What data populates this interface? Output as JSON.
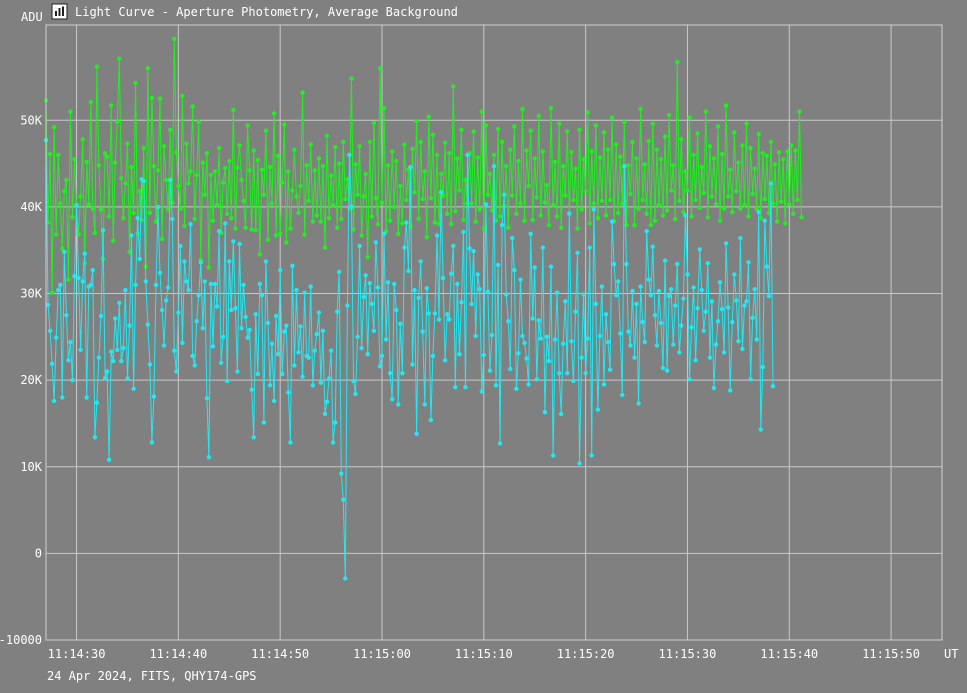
{
  "window": {
    "title": "Light Curve - Aperture Photometry, Average Background",
    "icon": "chart-icon"
  },
  "footer": "24 Apr 2024, FITS, QHY174-GPS",
  "colors": {
    "background": "#808080",
    "grid": "#c8c8c8",
    "series_green": "#22ee22",
    "series_cyan": "#22e8f2"
  },
  "chart_data": {
    "type": "line",
    "title": "Light Curve - Aperture Photometry, Average Background",
    "ylabel": "ADU",
    "xlabel": "UT",
    "ylim": [
      -10000,
      61000
    ],
    "xlim": [
      27,
      115
    ],
    "yticks": [
      {
        "value": 50000,
        "label": "50K"
      },
      {
        "value": 40000,
        "label": "40K"
      },
      {
        "value": 30000,
        "label": "30K"
      },
      {
        "value": 20000,
        "label": "20K"
      },
      {
        "value": 10000,
        "label": "10K"
      },
      {
        "value": 0,
        "label": "0"
      },
      {
        "value": -10000,
        "label": "-10000"
      }
    ],
    "xticks": [
      {
        "value": 30,
        "label": "11:14:30"
      },
      {
        "value": 40,
        "label": "11:14:40"
      },
      {
        "value": 50,
        "label": "11:14:50"
      },
      {
        "value": 60,
        "label": "11:15:00"
      },
      {
        "value": 70,
        "label": "11:15:10"
      },
      {
        "value": 80,
        "label": "11:15:20"
      },
      {
        "value": 90,
        "label": "11:15:30"
      },
      {
        "value": 100,
        "label": "11:15:40"
      },
      {
        "value": 110,
        "label": "11:15:50"
      }
    ],
    "grid": true,
    "x_start": 27,
    "x_step": 0.2,
    "series": [
      {
        "color": "#22ee22",
        "values": [
          52300,
          38200,
          46100,
          30100,
          49200,
          36800,
          46000,
          40400,
          35200,
          41800,
          43100,
          31600,
          51000,
          38800,
          45500,
          40200,
          36800,
          41200,
          47800,
          33500,
          45200,
          40300,
          52100,
          39800,
          37000,
          56200,
          44800,
          39700,
          34000,
          46200,
          45800,
          38900,
          51700,
          36100,
          45100,
          49800,
          57100,
          43300,
          38700,
          42700,
          47300,
          34800,
          44600,
          39300,
          54300,
          36900,
          41800,
          38500,
          46800,
          33100,
          56000,
          39300,
          52600,
          44700,
          38300,
          44200,
          52500,
          36300,
          47000,
          43100,
          39700,
          48900,
          40500,
          59400,
          46300,
          42400,
          39800,
          52800,
          37800,
          47300,
          42700,
          44100,
          51600,
          38600,
          43700,
          49800,
          33900,
          45100,
          41400,
          46200,
          33000,
          43700,
          38400,
          44100,
          40200,
          46800,
          37000,
          42800,
          44500,
          39200,
          45300,
          38700,
          51200,
          37500,
          44500,
          47100,
          43100,
          40700,
          37600,
          49400,
          44200,
          37400,
          46500,
          37300,
          45400,
          34500,
          44300,
          41400,
          48800,
          36200,
          44600,
          40400,
          50800,
          36700,
          45900,
          36900,
          42800,
          49500,
          35900,
          44100,
          37500,
          41900,
          46600,
          41200,
          39300,
          42400,
          53200,
          36800,
          44800,
          40700,
          47200,
          38300,
          44200,
          39000,
          45600,
          38300,
          44700,
          35300,
          48200,
          38700,
          43600,
          40200,
          46900,
          37600,
          45000,
          38600,
          47500,
          40900,
          43200,
          39800,
          54800,
          37400,
          44900,
          41400,
          47000,
          36700,
          41200,
          43800,
          34200,
          47500,
          38900,
          49700,
          41000,
          38000,
          56000,
          40500,
          51400,
          37200,
          44800,
          38400,
          46400,
          40000,
          45300,
          36900,
          42400,
          38100,
          47200,
          40800,
          44300,
          37700,
          46700,
          41700,
          49900,
          38600,
          47500,
          40900,
          44100,
          36500,
          50400,
          41000,
          48300,
          38200,
          46000,
          38000,
          43800,
          41300,
          47400,
          39200,
          46200,
          38000,
          53900,
          39500,
          45600,
          41900,
          48900,
          38500,
          43100,
          40400,
          46200,
          40400,
          48700,
          38300,
          45700,
          39700,
          51000,
          37500,
          49400,
          41400,
          43800,
          39600,
          46000,
          38400,
          49000,
          38900,
          47500,
          40100,
          44700,
          37600,
          46600,
          41300,
          49300,
          39200,
          45300,
          40400,
          51300,
          38400,
          46500,
          42400,
          48800,
          38500,
          45600,
          41100,
          50500,
          39000,
          46400,
          40500,
          42500,
          37900,
          51400,
          40200,
          45200,
          38900,
          49600,
          37600,
          44700,
          41300,
          48700,
          39300,
          46300,
          40800,
          44400,
          37500,
          48900,
          39700,
          45500,
          41800,
          50900,
          38100,
          46400,
          40400,
          49400,
          38700,
          45700,
          40700,
          48600,
          39000,
          46600,
          40800,
          50300,
          38300,
          47200,
          39300,
          45800,
          40400,
          49800,
          37900,
          44800,
          41500,
          47500,
          37900,
          45600,
          39800,
          51300,
          40800,
          44900,
          39200,
          47600,
          37900,
          49600,
          38400,
          46600,
          40200,
          45500,
          39000,
          48100,
          39600,
          50600,
          41900,
          44800,
          38600,
          56700,
          40700,
          47800,
          39400,
          44100,
          41900,
          50300,
          38900,
          46000,
          40800,
          48500,
          39900,
          44600,
          41600,
          51000,
          38800,
          47000,
          41200,
          45600,
          40300,
          49300,
          38400,
          46100,
          39800,
          51700,
          41200,
          44300,
          39400,
          48600,
          41800,
          45100,
          39800,
          47100,
          40200,
          49600,
          38900,
          46800,
          41500,
          44400,
          39800,
          48400,
          38700,
          46200,
          40900,
          45900,
          39300,
          47500,
          40400,
          44900,
          38300,
          46300,
          40600,
          45500,
          38100,
          46400,
          40300,
          47100,
          39200,
          46500,
          40800,
          51000,
          38800
        ]
      },
      {
        "color": "#22e8f2",
        "values": [
          47700,
          28700,
          25700,
          21900,
          17600,
          24900,
          30400,
          31000,
          18000,
          34800,
          27500,
          22300,
          24400,
          20000,
          32000,
          40200,
          31800,
          23500,
          31400,
          34600,
          18000,
          30800,
          31000,
          32700,
          13400,
          17400,
          22600,
          27400,
          37300,
          20200,
          21000,
          10800,
          23300,
          22200,
          27100,
          23500,
          28900,
          22200,
          23700,
          30400,
          20200,
          26300,
          36700,
          19000,
          31000,
          38700,
          34000,
          43200,
          43000,
          31400,
          26400,
          21800,
          12800,
          18100,
          31000,
          40000,
          32400,
          28100,
          24000,
          29200,
          30700,
          43100,
          38600,
          23400,
          21000,
          27800,
          35500,
          24300,
          33700,
          31400,
          30400,
          38000,
          22800,
          21700,
          26800,
          29800,
          33600,
          26000,
          31400,
          17900,
          11100,
          31100,
          23900,
          31100,
          28500,
          37200,
          22000,
          25000,
          38100,
          19900,
          33700,
          28100,
          36000,
          28300,
          21000,
          35700,
          26000,
          31000,
          27300,
          24900,
          25800,
          18900,
          13400,
          27600,
          20700,
          31100,
          29800,
          15100,
          33700,
          26600,
          19400,
          24200,
          17600,
          27400,
          23000,
          32700,
          20700,
          25600,
          26300,
          18600,
          12800,
          33200,
          21700,
          30400,
          23200,
          26200,
          20400,
          30100,
          22800,
          22600,
          30800,
          19400,
          23400,
          25300,
          27800,
          19700,
          25700,
          16100,
          17500,
          20200,
          23400,
          12800,
          15100,
          27900,
          32500,
          9200,
          6200,
          -2900,
          28600,
          46000,
          40000,
          19900,
          18400,
          25000,
          35500,
          23700,
          29600,
          32100,
          23000,
          31200,
          28800,
          25700,
          35900,
          30700,
          21600,
          22800,
          36900,
          24700,
          31300,
          20800,
          17800,
          31100,
          28100,
          17200,
          26500,
          20800,
          35300,
          38200,
          32600,
          44600,
          21800,
          30400,
          13800,
          29500,
          33700,
          25600,
          17200,
          30600,
          27700,
          15400,
          22800,
          27700,
          36700,
          27000,
          41700,
          31800,
          22300,
          27600,
          27000,
          32300,
          35500,
          19200,
          31100,
          23000,
          29000,
          37100,
          19200,
          46000,
          35200,
          28800,
          34900,
          25100,
          32200,
          30500,
          18700,
          22900,
          40300,
          30200,
          21100,
          25200,
          44700,
          19400,
          33300,
          12700,
          37900,
          41400,
          29900,
          26800,
          21300,
          36400,
          32700,
          19000,
          23100,
          31600,
          25100,
          24300,
          22500,
          19500,
          36900,
          27100,
          33000,
          20100,
          26900,
          24800,
          35300,
          16300,
          25000,
          22200,
          33100,
          11300,
          24700,
          30100,
          20800,
          16100,
          24200,
          29100,
          20800,
          39200,
          24500,
          19900,
          27900,
          34700,
          10400,
          22600,
          29900,
          20800,
          24800,
          35300,
          11300,
          39700,
          28800,
          16600,
          25100,
          30800,
          19500,
          27600,
          24400,
          21200,
          38300,
          33400,
          29800,
          31400,
          25400,
          18300,
          44700,
          33400,
          25600,
          24000,
          30300,
          22600,
          28800,
          17300,
          30800,
          26700,
          24400,
          37200,
          31600,
          29800,
          35400,
          27500,
          24000,
          30300,
          26600,
          21400,
          33800,
          21100,
          29700,
          30500,
          24100,
          28600,
          33400,
          23200,
          26300,
          29400,
          39000,
          32200,
          20100,
          26100,
          30700,
          22300,
          28300,
          35100,
          30400,
          25700,
          27900,
          33500,
          22600,
          29100,
          19100,
          24100,
          26800,
          31300,
          28200,
          23200,
          35800,
          28400,
          18800,
          26700,
          32200,
          29200,
          24500,
          36400,
          23600,
          28600,
          29100,
          33600,
          20100,
          27200,
          30500,
          24700,
          39400,
          14300,
          21500,
          38400,
          33100,
          29700,
          42700,
          19300
        ]
      }
    ]
  }
}
